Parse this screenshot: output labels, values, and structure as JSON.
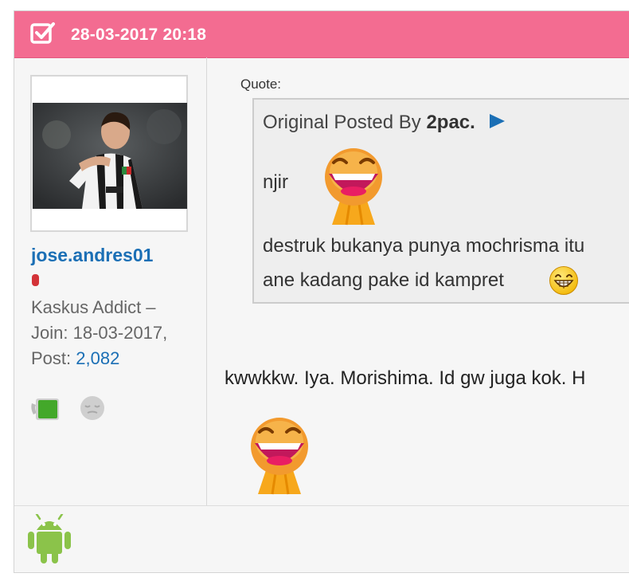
{
  "header": {
    "date": "28-03-2017 20:18",
    "icon": "checkbox-icon",
    "color": "#f36c91"
  },
  "user": {
    "avatar_icon": "avatar-photo",
    "username": "jose.andres01",
    "status_color": "#d33338",
    "rank": "Kaskus Addict –",
    "join_label": "Join:",
    "join_date": "18-03-2017,",
    "post_label": "Post:",
    "post_count": "2,082",
    "badges": [
      "mug-badge-icon",
      "sleepy-face-badge-icon"
    ]
  },
  "quote": {
    "label": "Quote:",
    "posted_by_prefix": "Original Posted By",
    "author": "2pac.",
    "goto_icon": "play-arrow-icon",
    "line1": "njir",
    "line2": "destruk bukanya punya mochrisma itu",
    "line3": "ane kadang pake id kampret",
    "emojis": [
      "laughing-emoji-icon",
      "grinning-emoji-icon"
    ]
  },
  "reply": {
    "text": "kwwkkw. Iya. Morishima. Id gw juga kok. H",
    "emoji": "laughing-emoji-icon"
  },
  "footer": {
    "device_icon": "android-icon"
  }
}
